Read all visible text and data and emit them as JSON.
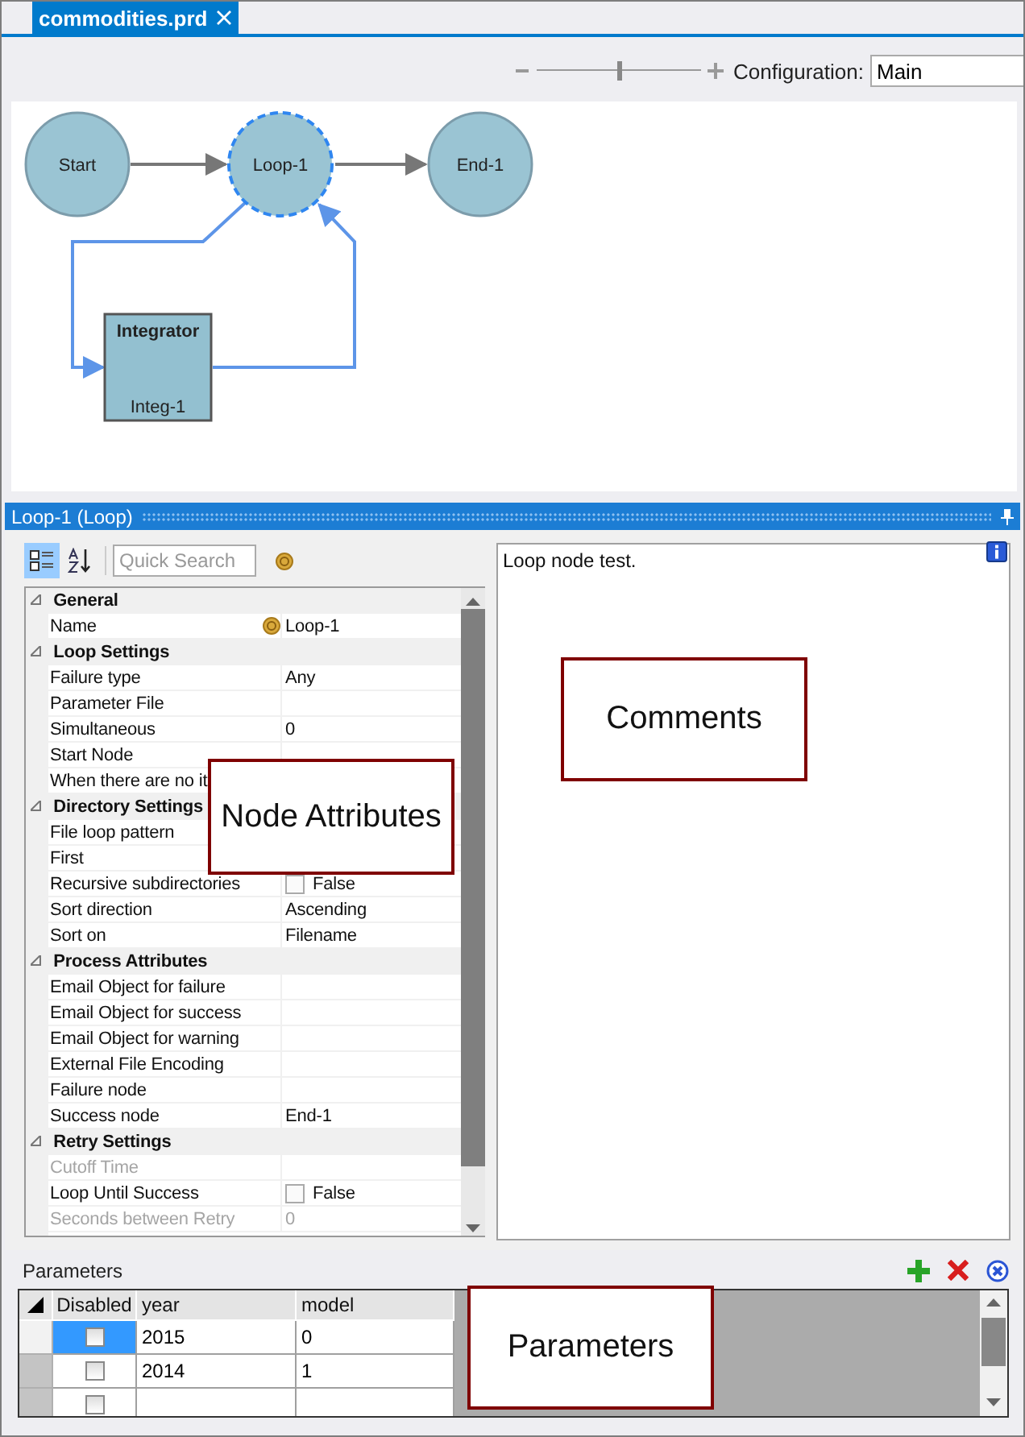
{
  "tabs": [
    {
      "label": "commodities.prd",
      "selected": true
    }
  ],
  "toolbar": {
    "zoom": {
      "level": 0.5
    },
    "configuration": {
      "label": "Configuration:",
      "value": "Main"
    }
  },
  "diagram": {
    "nodes": [
      {
        "kind": "circle",
        "label": "Start",
        "selected": false
      },
      {
        "kind": "circle",
        "label": "Loop-1",
        "selected": true
      },
      {
        "kind": "circle",
        "label": "End-1",
        "selected": false
      },
      {
        "kind": "box",
        "title": "Integrator",
        "label": "Integ-1",
        "selected": false
      }
    ]
  },
  "panel": {
    "title": "Loop-1 (Loop)"
  },
  "properties": {
    "view_buttons": [
      {
        "kind": "categorized",
        "selected": true
      },
      {
        "kind": "alphabetical",
        "selected": false
      }
    ],
    "search": {
      "placeholder": "Quick Search"
    },
    "groups": [
      {
        "title": "General",
        "expanded": true,
        "items": [
          {
            "name": "Name",
            "value": "Loop-1",
            "kind": "reference",
            "disabled": false
          }
        ]
      },
      {
        "title": "Loop Settings",
        "expanded": true,
        "items": [
          {
            "name": "Failure type",
            "value": "Any",
            "kind": "text",
            "disabled": false
          },
          {
            "name": "Parameter File",
            "kind": "text",
            "disabled": false
          },
          {
            "name": "Simultaneous",
            "value": "0",
            "kind": "text",
            "disabled": false
          },
          {
            "name": "Start Node",
            "kind": "text",
            "disabled": false
          },
          {
            "name": "When there are no it",
            "kind": "text",
            "disabled": false
          }
        ]
      },
      {
        "title": "Directory Settings",
        "expanded": true,
        "items": [
          {
            "name": "File loop pattern",
            "kind": "text",
            "disabled": false
          },
          {
            "name": "First",
            "kind": "text",
            "disabled": false
          },
          {
            "name": "Recursive subdirectories",
            "value": "False",
            "kind": "checkbox",
            "checked": false,
            "disabled": false
          },
          {
            "name": "Sort direction",
            "value": "Ascending",
            "kind": "text",
            "disabled": false
          },
          {
            "name": "Sort on",
            "value": "Filename",
            "kind": "text",
            "disabled": false
          }
        ]
      },
      {
        "title": "Process Attributes",
        "expanded": true,
        "items": [
          {
            "name": "Email Object for failure",
            "kind": "text",
            "disabled": false
          },
          {
            "name": "Email Object for success",
            "kind": "text",
            "disabled": false
          },
          {
            "name": "Email Object for warning",
            "kind": "text",
            "disabled": false
          },
          {
            "name": "External File Encoding",
            "kind": "text",
            "disabled": false
          },
          {
            "name": "Failure node",
            "kind": "text",
            "disabled": false
          },
          {
            "name": "Success node",
            "value": "End-1",
            "kind": "text",
            "disabled": false
          }
        ]
      },
      {
        "title": "Retry Settings",
        "expanded": true,
        "items": [
          {
            "name": "Cutoff Time",
            "kind": "text",
            "disabled": true
          },
          {
            "name": "Loop Until Success",
            "value": "False",
            "kind": "checkbox",
            "checked": false,
            "disabled": false
          },
          {
            "name": "Seconds between Retry",
            "value": "0",
            "kind": "text",
            "disabled": true
          }
        ]
      }
    ]
  },
  "comments": {
    "value": "Loop node test."
  },
  "parameters": {
    "title": "Parameters",
    "columns": [
      "Disabled",
      "year",
      "model"
    ],
    "rows": [
      {
        "disabled": false,
        "year": "2015",
        "model": "0",
        "selected": true
      },
      {
        "disabled": false,
        "year": "2014",
        "model": "1",
        "selected": false
      },
      {
        "disabled": false,
        "selected": false
      }
    ]
  },
  "callouts": [
    {
      "label": "Node Attributes"
    },
    {
      "label": "Comments"
    },
    {
      "label": "Parameters"
    }
  ]
}
